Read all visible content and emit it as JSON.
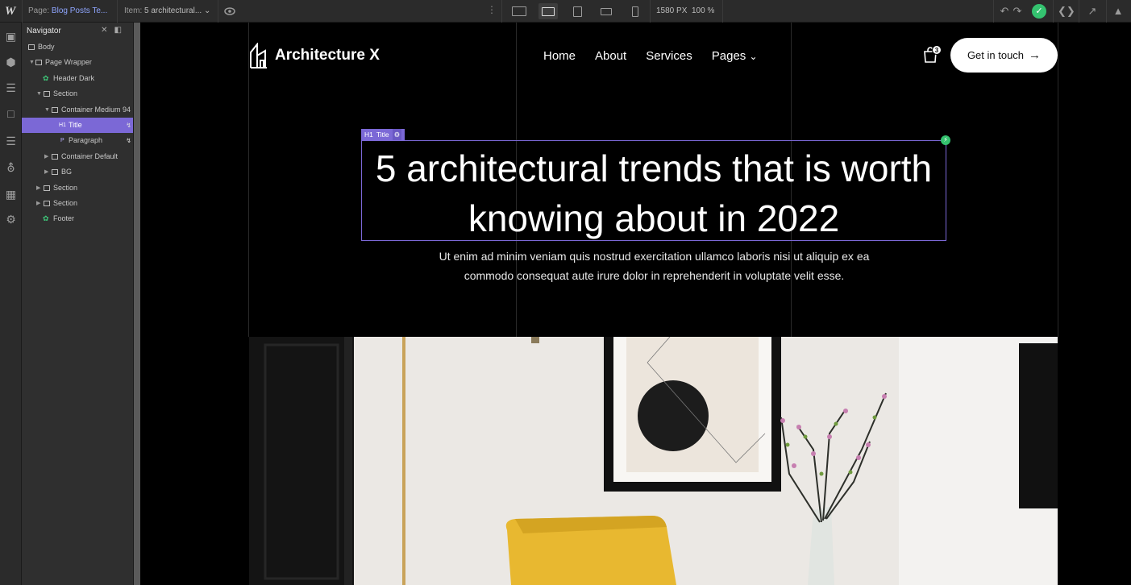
{
  "topbar": {
    "page_prefix": "Page:",
    "page_name": "Blog Posts Te...",
    "item_prefix": "Item:",
    "item_name": "5 architectural...",
    "width": "1580 PX",
    "zoom": "100 %"
  },
  "navigator": {
    "title": "Navigator",
    "tree": [
      {
        "label": "Body"
      },
      {
        "label": "Page Wrapper"
      },
      {
        "label": "Header Dark"
      },
      {
        "label": "Section"
      },
      {
        "label": "Container Medium 94"
      },
      {
        "label": "Title"
      },
      {
        "label": "Paragraph"
      },
      {
        "label": "Container Default"
      },
      {
        "label": "BG"
      },
      {
        "label": "Section"
      },
      {
        "label": "Section"
      },
      {
        "label": "Footer"
      }
    ]
  },
  "site": {
    "brand": "Architecture X",
    "menu": [
      "Home",
      "About",
      "Services",
      "Pages"
    ],
    "cart_count": "3",
    "cta": "Get in touch",
    "selection_tag": "H1",
    "selection_label": "Title",
    "title": "5 architectural trends that is worth knowing about in 2022",
    "paragraph": "Ut enim ad minim veniam quis nostrud exercitation ullamco laboris nisi ut aliquip ex ea commodo consequat aute irure dolor in reprehenderit in voluptate velit esse."
  },
  "colors": {
    "accent": "#7b68d6",
    "success": "#34c26f",
    "chair": "#e8b830"
  },
  "icons": {
    "left_rail": [
      "add-icon",
      "box-icon",
      "list-icon",
      "page-icon",
      "database-icon",
      "cart-icon",
      "assets-icon",
      "settings-icon"
    ]
  }
}
